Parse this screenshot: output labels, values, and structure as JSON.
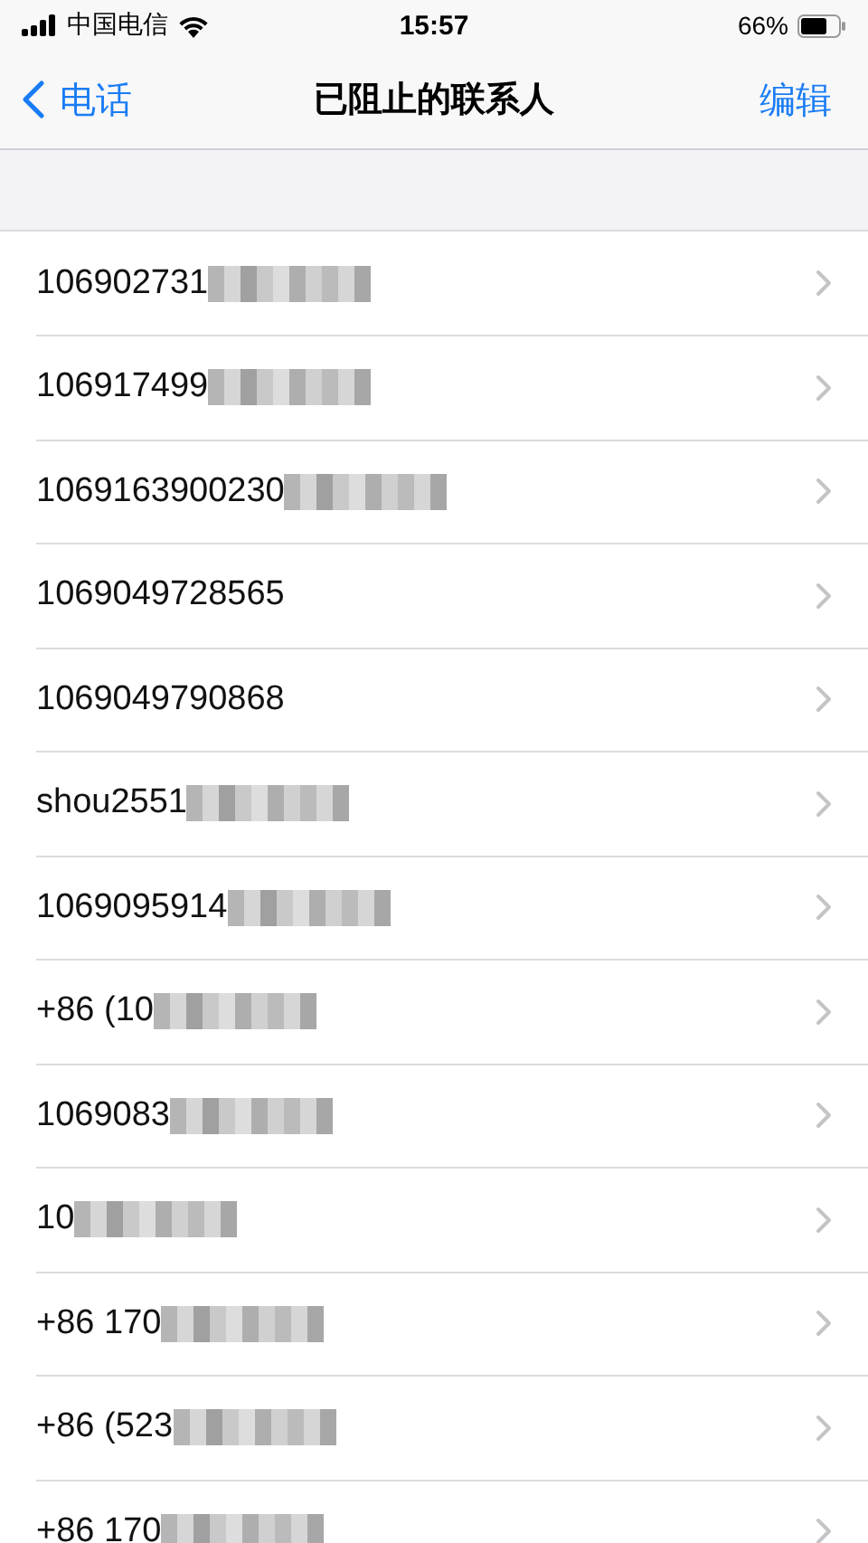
{
  "status_bar": {
    "carrier": "中国电信",
    "time": "15:57",
    "battery": "66%"
  },
  "nav": {
    "back": "电话",
    "title": "已阻止的联系人",
    "action": "编辑"
  },
  "contacts": [
    {
      "label": "106902731",
      "redacted": true
    },
    {
      "label": "106917499",
      "redacted": true
    },
    {
      "label": "1069163900230",
      "redacted": true
    },
    {
      "label": "1069049728565",
      "redacted": false
    },
    {
      "label": "1069049790868",
      "redacted": false
    },
    {
      "label": "shou2551",
      "redacted": true
    },
    {
      "label": "1069095914",
      "redacted": true
    },
    {
      "label": "+86 (10",
      "redacted": true
    },
    {
      "label": "1069083",
      "redacted": true
    },
    {
      "label": "10",
      "redacted": true
    },
    {
      "label": "+86 170",
      "redacted": true
    },
    {
      "label": "+86 (523",
      "redacted": true
    },
    {
      "label": "+86 170",
      "redacted": true
    }
  ]
}
